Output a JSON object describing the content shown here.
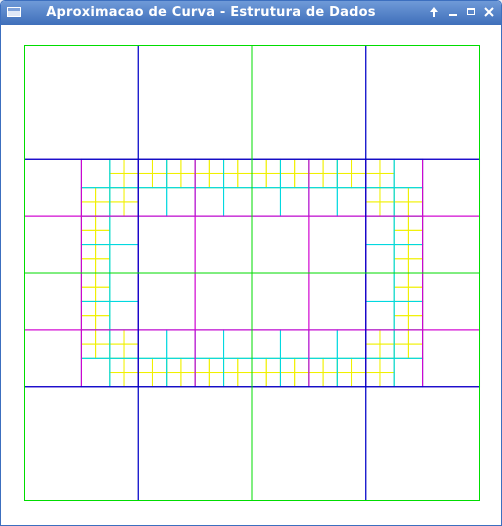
{
  "window": {
    "title": "Aproximacao de Curva - Estrutura de Dados",
    "buttons": {
      "up_icon": "arrow-up-icon",
      "minimize_icon": "minimize-icon",
      "maximize_icon": "maximize-icon",
      "close_icon": "close-icon"
    },
    "accent_color": "#3f6fba"
  },
  "quadtree": {
    "colors": {
      "level1": "#00dd00",
      "level2": "#0000c8",
      "level3": "#d000d0",
      "level4": "#00d8e0",
      "level5": "#f0f000"
    }
  }
}
